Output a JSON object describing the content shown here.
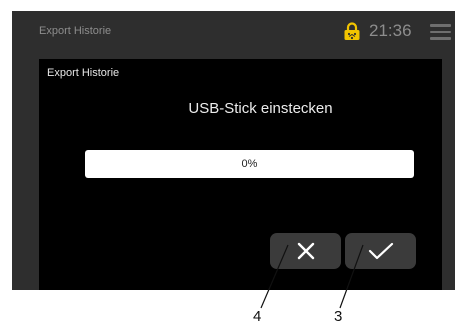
{
  "status_bar": {
    "title": "Export Historie",
    "time": "21:36",
    "lock_icon": "lock-icon",
    "menu_icon": "hamburger-menu-icon"
  },
  "dialog": {
    "title": "Export Historie",
    "prompt": "USB-Stick einstecken",
    "progress": {
      "percent": 0,
      "label": "0%"
    },
    "buttons": {
      "cancel_icon": "close-icon",
      "confirm_icon": "checkmark-icon"
    }
  },
  "callouts": {
    "cancel_number": "4",
    "confirm_number": "3"
  },
  "colors": {
    "screen_background": "#2e2e2e",
    "dialog_background": "#000000",
    "button_background": "#3b3b3b",
    "lock_icon": "#f2c400"
  }
}
